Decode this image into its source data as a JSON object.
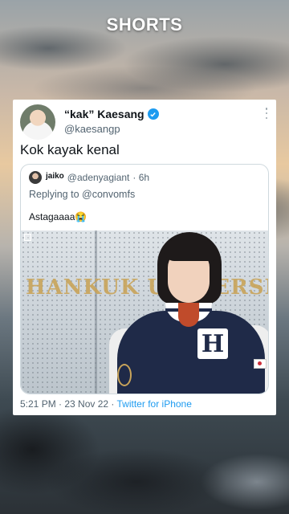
{
  "video": {
    "title": "SHORTS"
  },
  "tweet": {
    "display_name": "“kak” Kaesang",
    "handle": "@kaesangp",
    "text": "Kok kayak kenal",
    "timestamp": "5:21 PM · 23 Nov 22 · ",
    "source": "Twitter for iPhone"
  },
  "quoted_tweet": {
    "display_name": "jaiko",
    "handle": "@adenyagiant",
    "age": "· 6h",
    "replying_to": "Replying to @convomfs",
    "text": "Astagaaaa😭",
    "image_wall_text": "HANKUK UNIVERSITY"
  },
  "colors": {
    "link": "#1d9bf0",
    "muted": "#536471",
    "text": "#0f1419"
  },
  "icons": [
    "verified-badge-icon",
    "more-options-icon"
  ]
}
